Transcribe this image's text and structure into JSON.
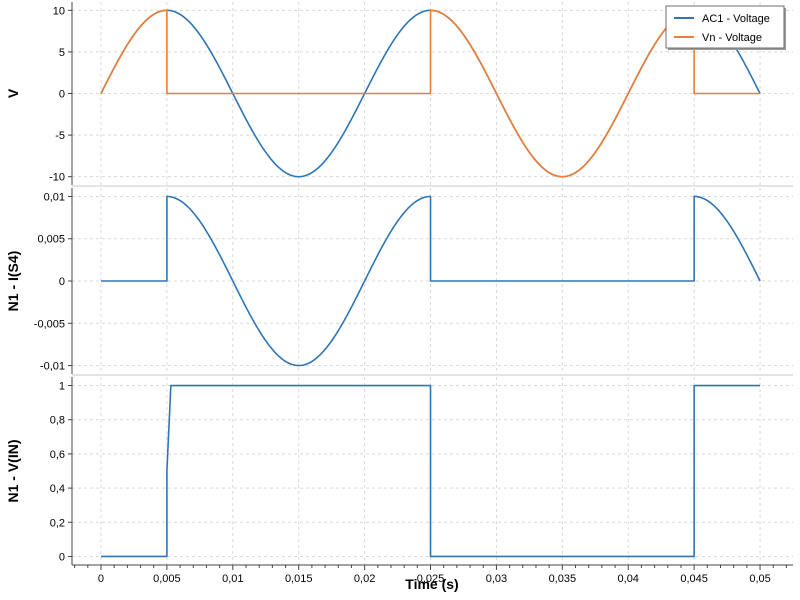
{
  "chart_data": [
    {
      "type": "line",
      "ylabel": "V",
      "ylim": [
        -11,
        11
      ],
      "yticks": [
        -10,
        -5,
        0,
        5,
        10
      ],
      "ytick_labels": [
        "-10",
        "-5",
        "0",
        "5",
        "10"
      ],
      "xlim": [
        -0.0022,
        0.0525
      ],
      "grid": true,
      "legend": {
        "placement": "top-right"
      },
      "series": [
        {
          "name": "AC1 - Voltage",
          "color": "#2e75b6",
          "function": "10*sin(2*pi*50*t)",
          "x": [
            0,
            0.0025,
            0.005,
            0.0075,
            0.01,
            0.0125,
            0.015,
            0.0175,
            0.02,
            0.0225,
            0.025,
            0.0275,
            0.03,
            0.0325,
            0.035,
            0.0375,
            0.04,
            0.0425,
            0.045,
            0.0475,
            0.05
          ],
          "y": [
            0,
            7.07,
            10,
            7.07,
            0,
            -7.07,
            -10,
            -7.07,
            0,
            7.07,
            10,
            7.07,
            0,
            -7.07,
            -10,
            -7.07,
            0,
            7.07,
            10,
            7.07,
            0
          ]
        },
        {
          "name": "Vn - Voltage",
          "color": "#ed7d31",
          "function": "10*sin(2*pi*50*t) when conducting, else 0",
          "x": [
            0,
            0.0025,
            0.005,
            0.005,
            0.025,
            0.025,
            0.0275,
            0.03,
            0.0325,
            0.035,
            0.0375,
            0.04,
            0.0425,
            0.045,
            0.045,
            0.05
          ],
          "y": [
            0,
            7.07,
            10,
            0,
            0,
            10,
            7.07,
            0,
            -7.07,
            -10,
            -7.07,
            0,
            7.07,
            10,
            0,
            0
          ]
        }
      ]
    },
    {
      "type": "line",
      "ylabel": "N1 - I(S4)",
      "ylim": [
        -0.011,
        0.011
      ],
      "yticks": [
        -0.01,
        -0.005,
        0,
        0.005,
        0.01
      ],
      "ytick_labels": [
        "-0,01",
        "-0,005",
        "0",
        "0,005",
        "0,01"
      ],
      "xlim": [
        -0.0022,
        0.0525
      ],
      "grid": true,
      "series": [
        {
          "color": "#2e75b6",
          "function": "0.01*sin(2*pi*50*t) when conducting, else 0",
          "x": [
            0,
            0.005,
            0.005,
            0.0075,
            0.01,
            0.0125,
            0.015,
            0.0175,
            0.02,
            0.0225,
            0.025,
            0.025,
            0.045,
            0.045,
            0.0475,
            0.05
          ],
          "y": [
            0,
            0,
            0.01,
            0.00707,
            0,
            -0.00707,
            -0.01,
            -0.00707,
            0,
            0.00707,
            0.01,
            0,
            0,
            0.01,
            0.00707,
            0
          ]
        }
      ]
    },
    {
      "type": "line",
      "ylabel": "N1 - V(IN)",
      "ylim": [
        -0.05,
        1.05
      ],
      "yticks": [
        0,
        0.2,
        0.4,
        0.6,
        0.8,
        1
      ],
      "ytick_labels": [
        "0",
        "0,2",
        "0,4",
        "0,6",
        "0,8",
        "1"
      ],
      "xlim": [
        -0.0022,
        0.0525
      ],
      "xlabel": "Time (s)",
      "xticks": [
        0,
        0.005,
        0.01,
        0.015,
        0.02,
        0.025,
        0.03,
        0.035,
        0.04,
        0.045,
        0.05
      ],
      "xtick_labels": [
        "0",
        "0,005",
        "0,01",
        "0,015",
        "0,02",
        "0,025",
        "0,03",
        "0,035",
        "0,04",
        "0,045",
        "0,05"
      ],
      "grid": true,
      "series": [
        {
          "color": "#2e75b6",
          "x": [
            0,
            0.005,
            0.005,
            0.0053,
            0.025,
            0.025,
            0.045,
            0.045,
            0.05
          ],
          "y": [
            0,
            0,
            0.5,
            1,
            1,
            0,
            0,
            1,
            1
          ]
        }
      ]
    }
  ]
}
